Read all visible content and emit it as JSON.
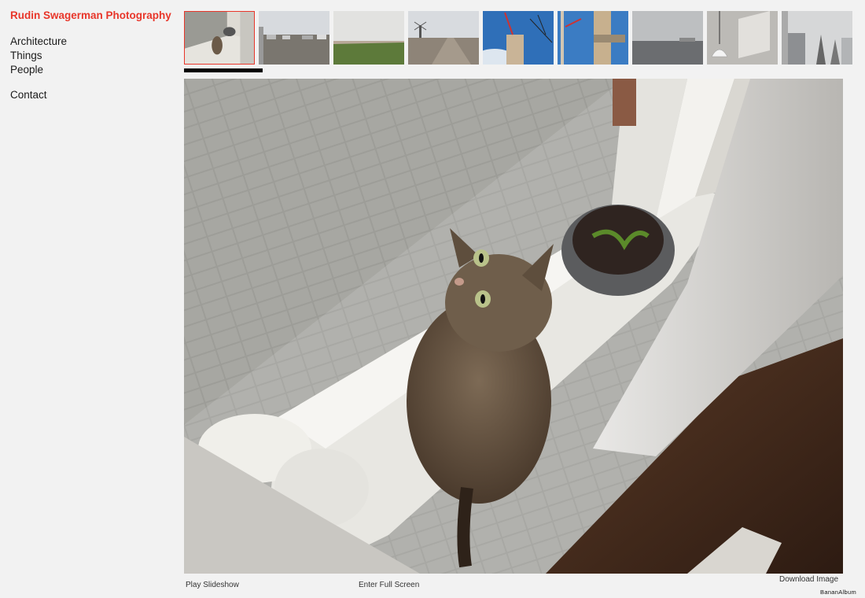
{
  "site": {
    "title": "Rudin Swagerman Photography"
  },
  "nav": {
    "items": [
      "Architecture",
      "Things",
      "People"
    ],
    "contact": "Contact"
  },
  "thumbnails": [
    {
      "name": "cat-window-thumb",
      "selected": true
    },
    {
      "name": "parking-lot-thumb",
      "selected": false
    },
    {
      "name": "grass-field-thumb",
      "selected": false
    },
    {
      "name": "road-windmill-thumb",
      "selected": false
    },
    {
      "name": "construction-crane-thumb",
      "selected": false
    },
    {
      "name": "building-crane-thumb",
      "selected": false
    },
    {
      "name": "foggy-water-thumb",
      "selected": false
    },
    {
      "name": "pendant-lamp-thumb",
      "selected": false
    },
    {
      "name": "foggy-buildings-thumb",
      "selected": false
    }
  ],
  "controls": {
    "play": "Play Slideshow",
    "fullscreen": "Enter Full Screen",
    "download": "Download Image"
  },
  "branding": {
    "powered_by": "BananAlbum"
  },
  "colors": {
    "accent": "#e8362a",
    "background": "#f2f2f2"
  }
}
